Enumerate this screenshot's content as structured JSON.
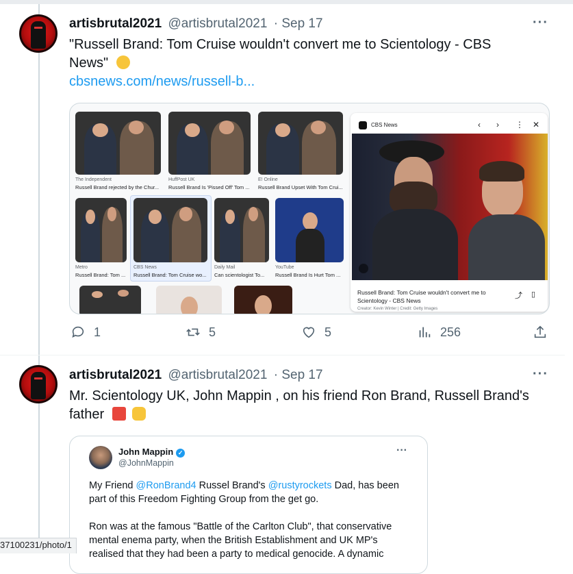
{
  "tweets": [
    {
      "name": "artisbrutal2021",
      "handle": "@artisbrutal2021",
      "date": "· Sep 17",
      "text_line1": "\"Russell Brand: Tom Cruise wouldn't convert me to Scientology - CBS",
      "text_line2": "News\"",
      "emoji": "thinking-face",
      "link": "cbsnews.com/news/russell-b...",
      "actions": {
        "replies": "1",
        "retweets": "5",
        "likes": "5",
        "views": "256"
      }
    },
    {
      "name": "artisbrutal2021",
      "handle": "@artisbrutal2021",
      "date": "· Sep 17",
      "text_line1": "Mr. Scientology UK, John Mappin , on his friend Ron Brand, Russell Brand's",
      "text_line2": "father",
      "emojis": [
        "popcorn",
        "backhand-index-pointing-down"
      ]
    }
  ],
  "card": {
    "thumbs": [
      {
        "source": "The Independent",
        "caption": "Russell Brand rejected by the Chur..."
      },
      {
        "source": "HuffPost UK",
        "caption": "Russell Brand Is 'Pissed Off' Tom ..."
      },
      {
        "source": "E! Online",
        "caption": "Russell Brand Upset With Tom Crui..."
      },
      {
        "source": "Metro",
        "caption": "Russell Brand: Tom ..."
      },
      {
        "source": "CBS News",
        "caption": "Russell Brand: Tom Cruise wo..."
      },
      {
        "source": "Daily Mail",
        "caption": "Can scientologist To..."
      },
      {
        "source": "YouTube",
        "caption": "Russell Brand Is Hurt Tom ..."
      }
    ],
    "panel": {
      "source": "CBS News",
      "caption": "Russell Brand: Tom Cruise wouldn't convert me to Scientology - CBS News",
      "credit": "Creator: Kevin Winter | Credit: Getty Images"
    }
  },
  "quote": {
    "name": "John Mappin",
    "handle": "@JohnMappin",
    "p1_a": "My Friend ",
    "p1_m1": "@RonBrand4",
    "p1_b": "  Russel Brand's ",
    "p1_m2": "@rustyrockets",
    "p1_c": "  Dad, has been",
    "p1_line2": "part of this Freedom Fighting Group from the get go.",
    "p2_line1": "Ron was at the famous \"Battle of the Carlton Club\", that conservative",
    "p2_line2": "mental enema party, when the British Establishment and UK MP's",
    "p2_line3": "realised that they had been a party to medical genocide. A dynamic"
  },
  "status_url": "37100231/photo/1",
  "colors": {
    "accent": "#1d9bf0",
    "muted": "#536471",
    "text": "#0f1419"
  }
}
